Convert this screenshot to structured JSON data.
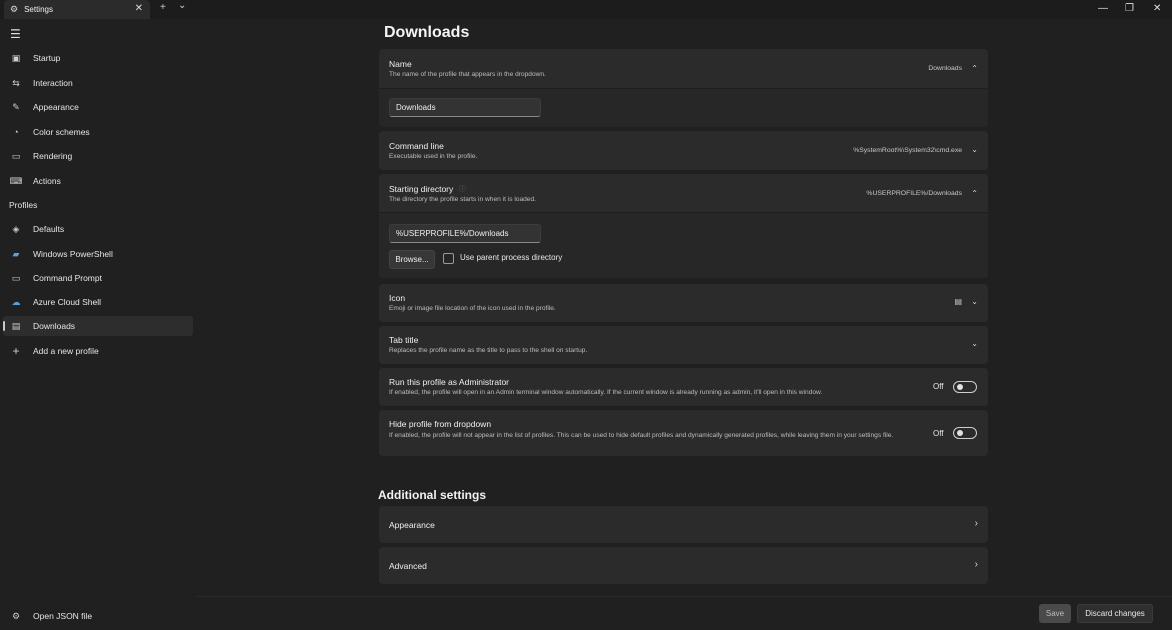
{
  "tab": {
    "icon": "gear-icon",
    "title": "Settings",
    "close": "✕"
  },
  "titlebar": {
    "new_tab": "+",
    "dropdown": "⌄",
    "minimize": "—",
    "restore": "❐",
    "close": "✕"
  },
  "sidebar": {
    "menu_icon": "☰",
    "items": [
      {
        "icon": "▣",
        "label": "Startup"
      },
      {
        "icon": "⇆",
        "label": "Interaction"
      },
      {
        "icon": "✎",
        "label": "Appearance"
      },
      {
        "icon": "◔",
        "label": "Color schemes"
      },
      {
        "icon": "▭",
        "label": "Rendering"
      },
      {
        "icon": "⌨",
        "label": "Actions"
      }
    ],
    "profiles_label": "Profiles",
    "profiles": [
      {
        "icon": "◈",
        "label": "Defaults"
      },
      {
        "icon": "▰",
        "label": "Windows PowerShell"
      },
      {
        "icon": "▭",
        "label": "Command Prompt"
      },
      {
        "icon": "☁",
        "label": "Azure Cloud Shell"
      },
      {
        "icon": "▤",
        "label": "Downloads"
      }
    ],
    "add_profile": {
      "icon": "+",
      "label": "Add a new profile"
    },
    "open_json": {
      "icon": "⚙",
      "label": "Open JSON file"
    }
  },
  "main": {
    "title": "Downloads",
    "name": {
      "label": "Name",
      "desc": "The name of the profile that appears in the dropdown.",
      "value": "Downloads",
      "input": "Downloads"
    },
    "command_line": {
      "label": "Command line",
      "desc": "Executable used in the profile.",
      "value": "%SystemRoot%\\System32\\cmd.exe"
    },
    "starting_dir": {
      "label": "Starting directory",
      "desc": "The directory the profile starts in when it is loaded.",
      "value": "%USERPROFILE%/Downloads",
      "input": "%USERPROFILE%/Downloads",
      "browse": "Browse...",
      "parent_label": "Use parent process directory"
    },
    "icon": {
      "label": "Icon",
      "desc": "Emoji or image file location of the icon used in the profile.",
      "value_icon": "▤"
    },
    "tab_title": {
      "label": "Tab title",
      "desc": "Replaces the profile name as the title to pass to the shell on startup."
    },
    "admin": {
      "label": "Run this profile as Administrator",
      "desc": "If enabled, the profile will open in an Admin terminal window automatically. If the current window is already running as admin, it'll open in this window.",
      "state": "Off"
    },
    "hide": {
      "label": "Hide profile from dropdown",
      "desc": "If enabled, the profile will not appear in the list of profiles. This can be used to hide default profiles and dynamically generated profiles, while leaving them in your settings file.",
      "state": "Off"
    },
    "additional_title": "Additional settings",
    "appearance": "Appearance",
    "advanced": "Advanced"
  },
  "footer": {
    "save": "Save",
    "discard": "Discard changes"
  },
  "glyphs": {
    "up": "⌃",
    "down": "⌄",
    "right": "›",
    "info": "ⓘ"
  }
}
